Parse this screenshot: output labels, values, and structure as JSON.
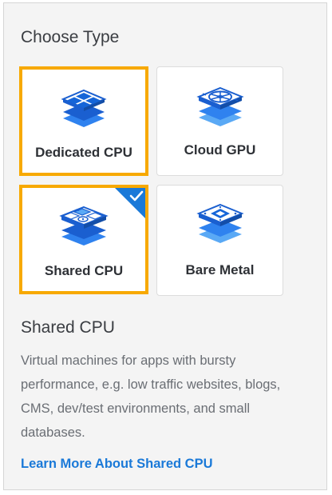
{
  "section": {
    "title": "Choose Type"
  },
  "types": [
    {
      "label": "Dedicated CPU",
      "icon": "dedicated-cpu-icon",
      "state": "hover"
    },
    {
      "label": "Cloud GPU",
      "icon": "cloud-gpu-icon",
      "state": "default"
    },
    {
      "label": "Shared CPU",
      "icon": "shared-cpu-icon",
      "state": "selected"
    },
    {
      "label": "Bare Metal",
      "icon": "bare-metal-icon",
      "state": "default"
    }
  ],
  "details": {
    "title": "Shared CPU",
    "description": "Virtual machines for apps with bursty performance, e.g. low traffic websites, blogs, CMS, dev/test environments, and small databases.",
    "link": "Learn More About Shared CPU"
  },
  "colors": {
    "accent_border": "#f7a900",
    "selected_badge": "#1a79d8",
    "link": "#1a79d8",
    "icon_dark": "#1565d8",
    "icon_light": "#5aa9f5"
  }
}
